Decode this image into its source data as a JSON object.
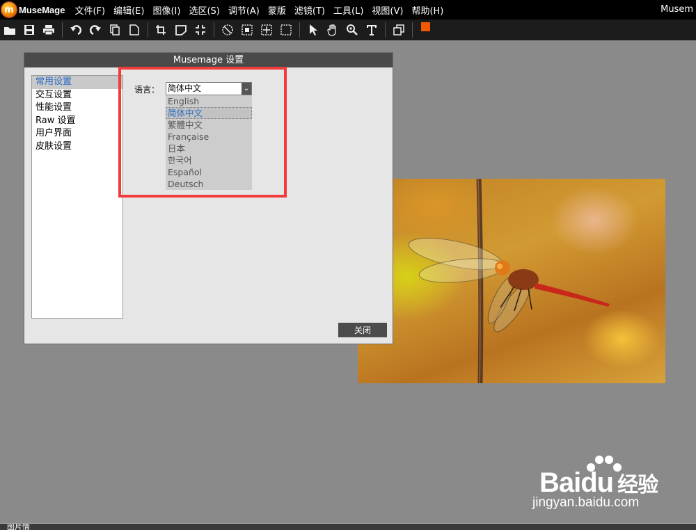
{
  "menubar": {
    "logo_text": "MuseMage",
    "items": [
      "文件(F)",
      "编辑(E)",
      "图像(I)",
      "选区(S)",
      "调节(A)",
      "蒙版",
      "滤镜(T)",
      "工具(L)",
      "视图(V)",
      "帮助(H)"
    ],
    "app_title": "Musem"
  },
  "toolbar": {
    "icons": [
      "open-icon",
      "save-icon",
      "print-icon",
      "undo-icon",
      "redo-icon",
      "copy-icon",
      "new-doc-icon",
      "crop-icon",
      "transform-icon",
      "shrink-icon",
      "deselect-icon",
      "rect-select-icon",
      "move-select-icon",
      "dashed-select-icon",
      "pointer-icon",
      "hand-icon",
      "zoom-icon",
      "text-icon",
      "layers-icon"
    ],
    "fg_color": "#f25a00",
    "bg_color": "#38d9f2"
  },
  "dialog": {
    "title": "Musemage 设置",
    "categories": [
      "常用设置",
      "交互设置",
      "性能设置",
      "Raw 设置",
      "用户界面",
      "皮肤设置"
    ],
    "selected_category": "常用设置",
    "language_label": "语言：",
    "language_value": "简体中文",
    "language_options": [
      "English",
      "简体中文",
      "繁體中文",
      "Française",
      "日本",
      "한국어",
      "Español",
      "Deutsch"
    ],
    "highlighted_option": "简体中文",
    "close_label": "关闭"
  },
  "watermark": {
    "brand": "Bai",
    "brand_tail": "du",
    "brand_cn": "经验",
    "url": "jingyan.baidu.com"
  },
  "statusbar": {
    "text": "图片情"
  }
}
